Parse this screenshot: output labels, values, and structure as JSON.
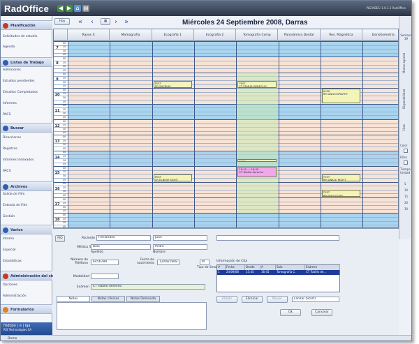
{
  "app": {
    "title": "RadOffice",
    "user_info": "PLEIADES: 1.0.1.1 RadOffice",
    "status": "Demo"
  },
  "toolbar": {
    "back_icon": "back-arrow-icon",
    "forward_icon": "forward-arrow-icon",
    "home_icon": "home-icon",
    "print_icon": "printer-icon"
  },
  "sidebar": {
    "sections": [
      {
        "label": "Planificación",
        "icon": "planning-icon",
        "color": "#c0392b",
        "items": [
          "Solicitudes de estudio",
          "Agenda"
        ]
      },
      {
        "label": "Listas de Trabajo",
        "icon": "worklist-icon",
        "color": "#2f5fb4",
        "items": [
          "Admisiones",
          "Estudios pendientes",
          "Estudios Completados",
          "Informes",
          "PACS"
        ]
      },
      {
        "label": "Buscar",
        "icon": "search-icon",
        "color": "#2f5fb4",
        "items": [
          "Direcciones",
          "Registros",
          "Informes Indexados",
          "PACS"
        ]
      },
      {
        "label": "Archivos",
        "icon": "archive-icon",
        "color": "#2f5fb4",
        "items": [
          "Salida de Film",
          "Entrada de Film",
          "Gestión"
        ]
      },
      {
        "label": "Varios",
        "icon": "misc-icon",
        "color": "#2f5fb4",
        "items": [
          "Interno",
          "Especial",
          "Estadísticas"
        ]
      },
      {
        "label": "Administración del sistema",
        "icon": "admin-icon",
        "color": "#c0392b",
        "items": [
          "Opciones",
          "Administración"
        ]
      },
      {
        "label": "Formularios",
        "icon": "forms-icon",
        "color": "#e67e22",
        "items": []
      }
    ],
    "logo_line1": "fridtjon | e | lga",
    "logo_line2": "RIS Technologies SA"
  },
  "nav": {
    "today_label": "Hoy",
    "first": "«",
    "prev": "‹",
    "next": "›",
    "last": "»",
    "date_title": "Miércoles 24 Septiembre 2008, Darras"
  },
  "columns": [
    "Rayos X",
    "Mamografía",
    "Ecografía 1",
    "Ecografía 2",
    "Tomografía Comp",
    "Panorámica Dental",
    "Res. Magnética",
    "Densitometría"
  ],
  "right_panel": {
    "week_label": "Semana 39",
    "tabs": [
      "Modos agenda",
      "Disponibilidad",
      "Citas"
    ],
    "color_label": "Color",
    "filter_label": "Filtro",
    "time_label": "Tiempo Unidad",
    "time_options": [
      "5",
      "10",
      "15",
      "20",
      "30"
    ]
  },
  "schedule": {
    "hours": [
      "7",
      "8",
      "9",
      "10",
      "11",
      "12",
      "13",
      "14",
      "15",
      "16",
      "17",
      "18"
    ],
    "minutes": [
      "00",
      "15",
      "30",
      "45"
    ],
    "appointments": [
      {
        "col": 2,
        "hour": 9,
        "quarter": 2,
        "span": 2,
        "line1": "TEST",
        "line2": "CR SACRUM",
        "color": "#f4f4b8"
      },
      {
        "col": 4,
        "hour": 9,
        "quarter": 2,
        "span": 2,
        "line1": "TEST",
        "line2": "CT FEMUR DERECHO",
        "color": "#f4f4b8"
      },
      {
        "col": 6,
        "hour": 10,
        "quarter": 0,
        "span": 4,
        "line1": "ALEX",
        "line2": "RM ANGIOGRAPHY",
        "color": "#f4f4b8"
      },
      {
        "col": 4,
        "hour": 14,
        "quarter": 2,
        "span": 1,
        "line1": "TEST",
        "line2": "CT TÓRAX",
        "color": "#f4f4b8"
      },
      {
        "col": 2,
        "hour": 15,
        "quarter": 2,
        "span": 2,
        "line1": "TEST",
        "line2": "CR ELBOW RIGHT",
        "color": "#f4f4b8"
      },
      {
        "col": 4,
        "hour": 15,
        "quarter": 0,
        "span": 3,
        "line1": "15:45 — 16:45",
        "line2": "CT Tobillo derecho",
        "color": "#f0a8e8"
      },
      {
        "col": 6,
        "hour": 15,
        "quarter": 2,
        "span": 2,
        "line1": "TEST",
        "line2": "RM ANKLE RIGHT",
        "color": "#f4f4b8"
      },
      {
        "col": 6,
        "hour": 16,
        "quarter": 2,
        "span": 2,
        "line1": "TEST",
        "line2": "RM SHOULDER",
        "color": "#f4f4b8"
      }
    ]
  },
  "form": {
    "pid_label": "PID",
    "patient_label": "Paciente",
    "patient_last": "Fernandez",
    "patient_first": "Juan",
    "doctor_label": "Médico Sol.",
    "doctor_last": "Bolo",
    "doctor_first": "Pedro",
    "last_name_caption": "Apellido",
    "first_name_caption": "Nombre",
    "phone_label": "Número de Teléfono",
    "phone_value": "6456789",
    "birth_label": "Fecha de nacimiento",
    "birth_value": "12/08/1968",
    "sex_label": "Tipo de Sexo",
    "sex_value": "M",
    "modality_label": "Modalidad",
    "exam_label": "Exámen",
    "exam_value": "CT Tobillo derecho",
    "location_label": "Información de Cita",
    "location_headers": [
      "#",
      "Fecha",
      "Desde",
      "A",
      "Sala",
      "Exámen"
    ],
    "location_row": [
      "1",
      "24/09/08",
      "15:45",
      "16:45",
      "Tomografía C.",
      "CT Tobillo de..."
    ],
    "tabs": [
      "Notas",
      "Notas clínicas",
      "Notas Demanda"
    ],
    "buttons": {
      "add": "Añadir",
      "delete": "Eliminar",
      "move": "Mover",
      "ok": "Ok",
      "cancel": "Cancelar",
      "schedule": "Lanzar (Start)"
    }
  }
}
